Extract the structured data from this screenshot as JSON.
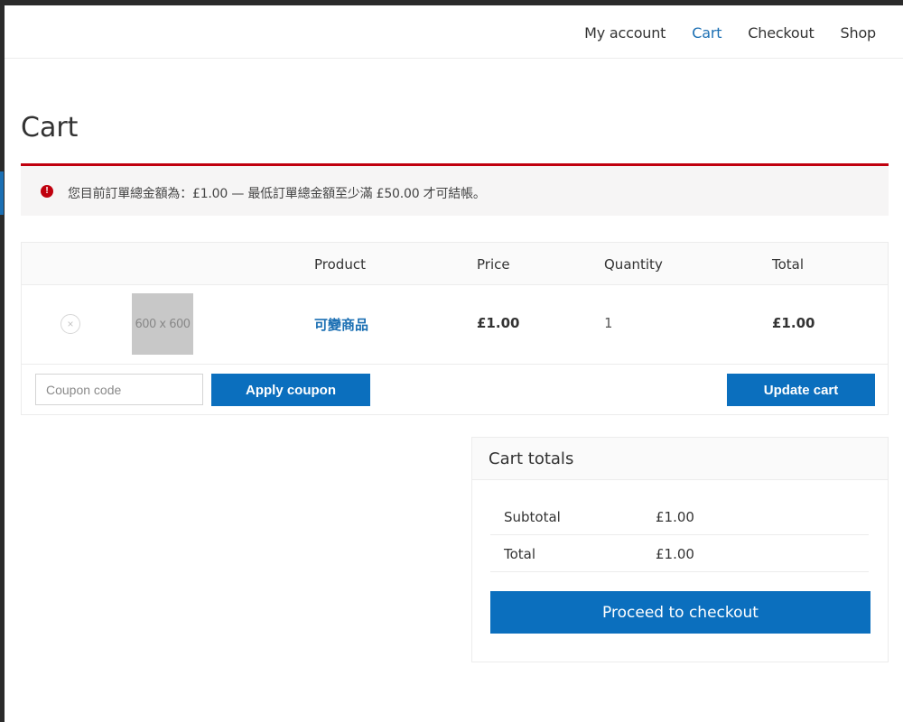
{
  "nav": {
    "items": [
      {
        "label": "My account"
      },
      {
        "label": "Cart",
        "active": true
      },
      {
        "label": "Checkout"
      },
      {
        "label": "Shop"
      }
    ]
  },
  "page": {
    "title": "Cart"
  },
  "notice": {
    "type": "error",
    "message": "您目前訂單總金額為：£1.00 — 最低訂單總金額至少滿 £50.00 才可結帳。",
    "color": "#c0000e"
  },
  "cart_table": {
    "headers": {
      "product": "Product",
      "price": "Price",
      "quantity": "Quantity",
      "total": "Total"
    },
    "rows": [
      {
        "thumbnail_text": "600 x 600",
        "product": "可變商品",
        "price": "£1.00",
        "quantity": "1",
        "total": "£1.00"
      }
    ],
    "remove_symbol": "×",
    "coupon_placeholder": "Coupon code",
    "apply_coupon_label": "Apply coupon",
    "update_cart_label": "Update cart"
  },
  "cart_totals": {
    "title": "Cart totals",
    "subtotal_label": "Subtotal",
    "subtotal_value": "£1.00",
    "total_label": "Total",
    "total_value": "£1.00",
    "checkout_label": "Proceed to checkout"
  },
  "colors": {
    "accent": "#0b6fbe",
    "link": "#1b6fb3",
    "error": "#c0000e"
  },
  "icons": {
    "notice": "error-icon",
    "remove": "close-circle-icon"
  }
}
